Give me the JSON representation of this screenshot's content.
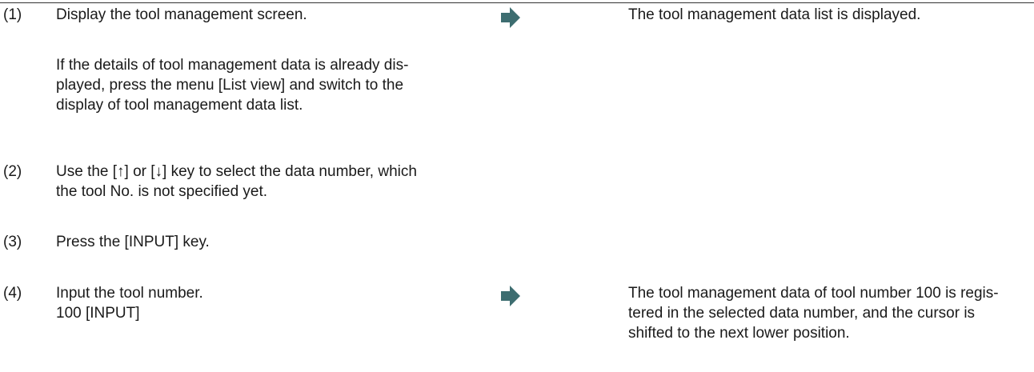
{
  "steps": [
    {
      "number": "(1)",
      "action_lines": [
        "Display the tool management screen."
      ],
      "note_lines": [
        "If the details of tool management data is already dis-",
        "played, press the menu [List view] and switch to the",
        "display of tool management data list."
      ],
      "result_lines": [
        "The tool management data list is displayed."
      ]
    },
    {
      "number": "(2)",
      "action_lines": [
        "Use the [↑] or [↓] key to select the data number, which",
        "the tool No. is not specified yet."
      ]
    },
    {
      "number": "(3)",
      "action_lines": [
        "Press the [INPUT] key."
      ]
    },
    {
      "number": "(4)",
      "action_lines": [
        "Input the tool number.",
        "100 [INPUT]"
      ],
      "result_lines": [
        "The tool management data of tool number 100 is regis-",
        "tered in the selected data number, and the cursor is",
        "shifted to the next lower position."
      ]
    }
  ],
  "colors": {
    "arrow": "#3d6d70",
    "text": "#1a1a1a",
    "rule": "#333333"
  },
  "icons": {
    "result_arrow": "right-arrow-icon"
  }
}
